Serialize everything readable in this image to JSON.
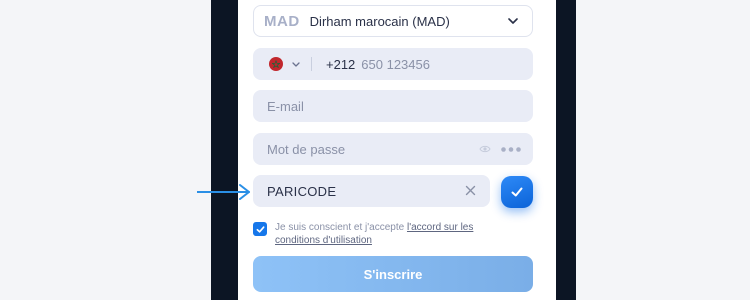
{
  "currency": {
    "code": "MAD",
    "name": "Dirham marocain (MAD)",
    "icon": "chevron-down-icon"
  },
  "phone": {
    "flag": "morocco-flag-icon",
    "dial_code": "+212",
    "placeholder": "650 123456"
  },
  "email": {
    "placeholder": "E-mail"
  },
  "password": {
    "placeholder": "Mot de passe",
    "icons": [
      "eye-icon",
      "more-dots-icon"
    ]
  },
  "promo": {
    "value": "PARICODE",
    "clear_icon": "close-icon",
    "confirm_icon": "check-icon"
  },
  "terms": {
    "checked": true,
    "text_before": "Je suis conscient et j'accepte ",
    "link_text": "l'accord sur les conditions d'utilisation"
  },
  "submit": {
    "label": "S'inscrire"
  },
  "colors": {
    "accent": "#1677ea",
    "field_bg": "#e9ecf6",
    "arrow": "#2a8fe6",
    "submit_gradient_start": "#8ec2f7",
    "submit_gradient_end": "#7aaee7"
  }
}
